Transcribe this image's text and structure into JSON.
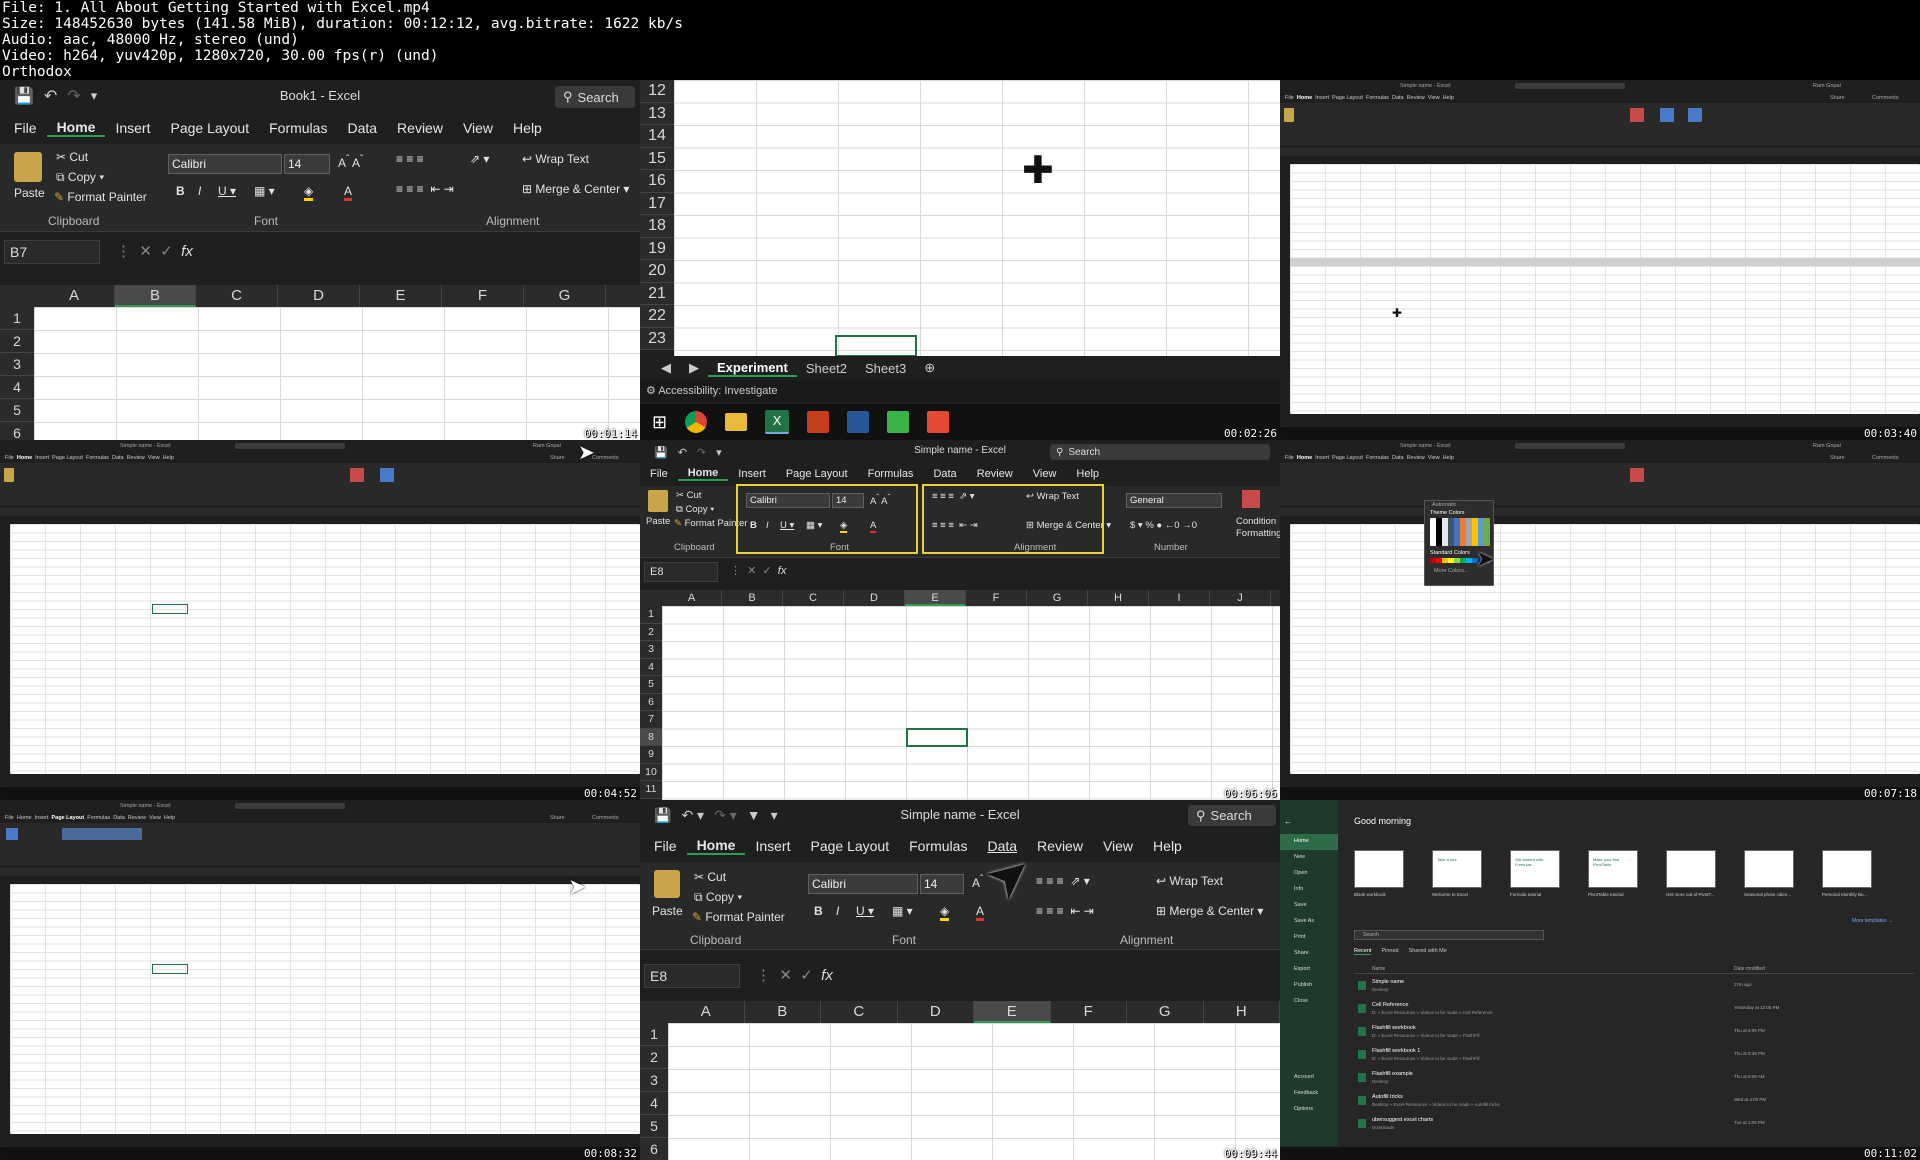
{
  "header": {
    "file": "File: 1. All About Getting Started with Excel.mp4",
    "size": "Size: 148452630 bytes (141.58 MiB), duration: 00:12:12, avg.bitrate: 1622 kb/s",
    "audio": "Audio: aac, 48000 Hz, stereo (und)",
    "video": "Video: h264, yuv420p, 1280x720, 30.00 fps(r) (und)",
    "author": "Orthodox"
  },
  "timestamps": [
    "00:01:14",
    "00:02:26",
    "00:03:40",
    "00:04:52",
    "00:06:06",
    "00:07:18",
    "00:08:32",
    "00:09:44",
    "00:11:02"
  ],
  "tile1": {
    "title": "Book1  -  Excel",
    "search": "Search",
    "tabs": [
      "File",
      "Home",
      "Insert",
      "Page Layout",
      "Formulas",
      "Data",
      "Review",
      "View",
      "Help"
    ],
    "clipboard": {
      "paste": "Paste",
      "cut": "Cut",
      "copy": "Copy",
      "format_painter": "Format Painter",
      "group": "Clipboard"
    },
    "font": {
      "name": "Calibri",
      "size": "14",
      "group": "Font"
    },
    "alignment": {
      "wrap": "Wrap Text",
      "merge": "Merge & Center",
      "group": "Alignment"
    },
    "namebox": "B7",
    "columns": [
      "A",
      "B",
      "C",
      "D",
      "E",
      "F",
      "G"
    ],
    "rows": [
      "1",
      "2",
      "3",
      "4",
      "5",
      "6"
    ]
  },
  "tile2": {
    "rows": [
      "12",
      "13",
      "14",
      "15",
      "16",
      "17",
      "18",
      "19",
      "20",
      "21",
      "22",
      "23"
    ],
    "sheets": [
      "Experiment",
      "Sheet2",
      "Sheet3"
    ],
    "status": "Accessibility: Investigate"
  },
  "tile5": {
    "title": "Simple name  -  Excel",
    "search": "Search",
    "tabs": [
      "File",
      "Home",
      "Insert",
      "Page Layout",
      "Formulas",
      "Data",
      "Review",
      "View",
      "Help"
    ],
    "clipboard": {
      "paste": "Paste",
      "cut": "Cut",
      "copy": "Copy",
      "format_painter": "Format Painter",
      "group": "Clipboard"
    },
    "font": {
      "name": "Calibri",
      "size": "14",
      "group": "Font"
    },
    "alignment": {
      "wrap": "Wrap Text",
      "merge": "Merge & Center",
      "group": "Alignment"
    },
    "number": {
      "format": "General",
      "group": "Number",
      "cond": "Condition",
      "cond2": "Formatting"
    },
    "namebox": "E8",
    "columns": [
      "A",
      "B",
      "C",
      "D",
      "E",
      "F",
      "G",
      "H",
      "I",
      "J"
    ],
    "rows": [
      "1",
      "2",
      "3",
      "4",
      "5",
      "6",
      "7",
      "8",
      "9",
      "10",
      "11"
    ]
  },
  "tile8": {
    "title": "Simple name  -  Excel",
    "search": "Search",
    "tabs": [
      "File",
      "Home",
      "Insert",
      "Page Layout",
      "Formulas",
      "Data",
      "Review",
      "View",
      "Help"
    ],
    "clipboard": {
      "paste": "Paste",
      "cut": "Cut",
      "copy": "Copy",
      "format_painter": "Format Painter",
      "group": "Clipboard"
    },
    "font": {
      "name": "Calibri",
      "size": "14",
      "group": "Font"
    },
    "alignment": {
      "wrap": "Wrap Text",
      "merge": "Merge & Center",
      "group": "Alignment"
    },
    "namebox": "E8",
    "columns": [
      "A",
      "B",
      "C",
      "D",
      "E",
      "F",
      "G",
      "H"
    ],
    "rows": [
      "1",
      "2",
      "3",
      "4",
      "5",
      "6"
    ]
  },
  "tile9": {
    "greeting": "Good morning",
    "nav": [
      "Home",
      "New",
      "Open",
      "Info",
      "Save",
      "Save As",
      "Print",
      "Share",
      "Export",
      "Publish",
      "Close",
      "Account",
      "Feedback",
      "Options"
    ],
    "templates": [
      "Blank workbook",
      "Welcome to Excel",
      "Formula tutorial",
      "PivotTable tutorial",
      "Get more out of PivotT...",
      "Seasonal photo calen...",
      "Personal Monthly Bu..."
    ],
    "template_cards": [
      "Take a tour",
      "Get started with Formulas",
      "Make your first PivotTable"
    ],
    "more": "More templates →",
    "search": "Search",
    "filters": [
      "Recent",
      "Pinned",
      "Shared with Me"
    ],
    "col_name": "Name",
    "col_date": "Date modified",
    "files": [
      {
        "name": "Simple name",
        "path": "Desktop",
        "date": "27m ago"
      },
      {
        "name": "Cell Reference",
        "path": "D: » Excel Resources » Videos to be made » Cell Reference",
        "date": "Yesterday at 12:05 PM"
      },
      {
        "name": "Flashfill workbook",
        "path": "D: » Excel Resources » Videos to be made » FlashFill",
        "date": "Thu at 6:06 PM"
      },
      {
        "name": "Flashfill workbook 1",
        "path": "D: » Excel Resources » Videos to be made » FlashFill",
        "date": "Thu at 5:48 PM"
      },
      {
        "name": "Flashfill example",
        "path": "Desktop",
        "date": "Thu at 9:08 AM"
      },
      {
        "name": "Autofill tricks",
        "path": "Desktop » Excel Resources » Videos to be made » Autofill tricks",
        "date": "Wed at 4:00 PM"
      },
      {
        "name": "ubersuggest excel charts",
        "path": "Downloads",
        "date": "Tue at 1:05 PM"
      }
    ]
  },
  "mini": {
    "title": "Simple name  -  Excel",
    "user": "Ram Gopal",
    "share": "Share",
    "comments": "Comments",
    "theme_colors": "Theme Colors",
    "standard_colors": "Standard Colors",
    "more_colors": "More Colors...",
    "automatic": "Automatic"
  },
  "colors": {
    "excel_green": "#217346",
    "highlight": "#e8d23a",
    "dark_bg": "#1f1f1f"
  }
}
